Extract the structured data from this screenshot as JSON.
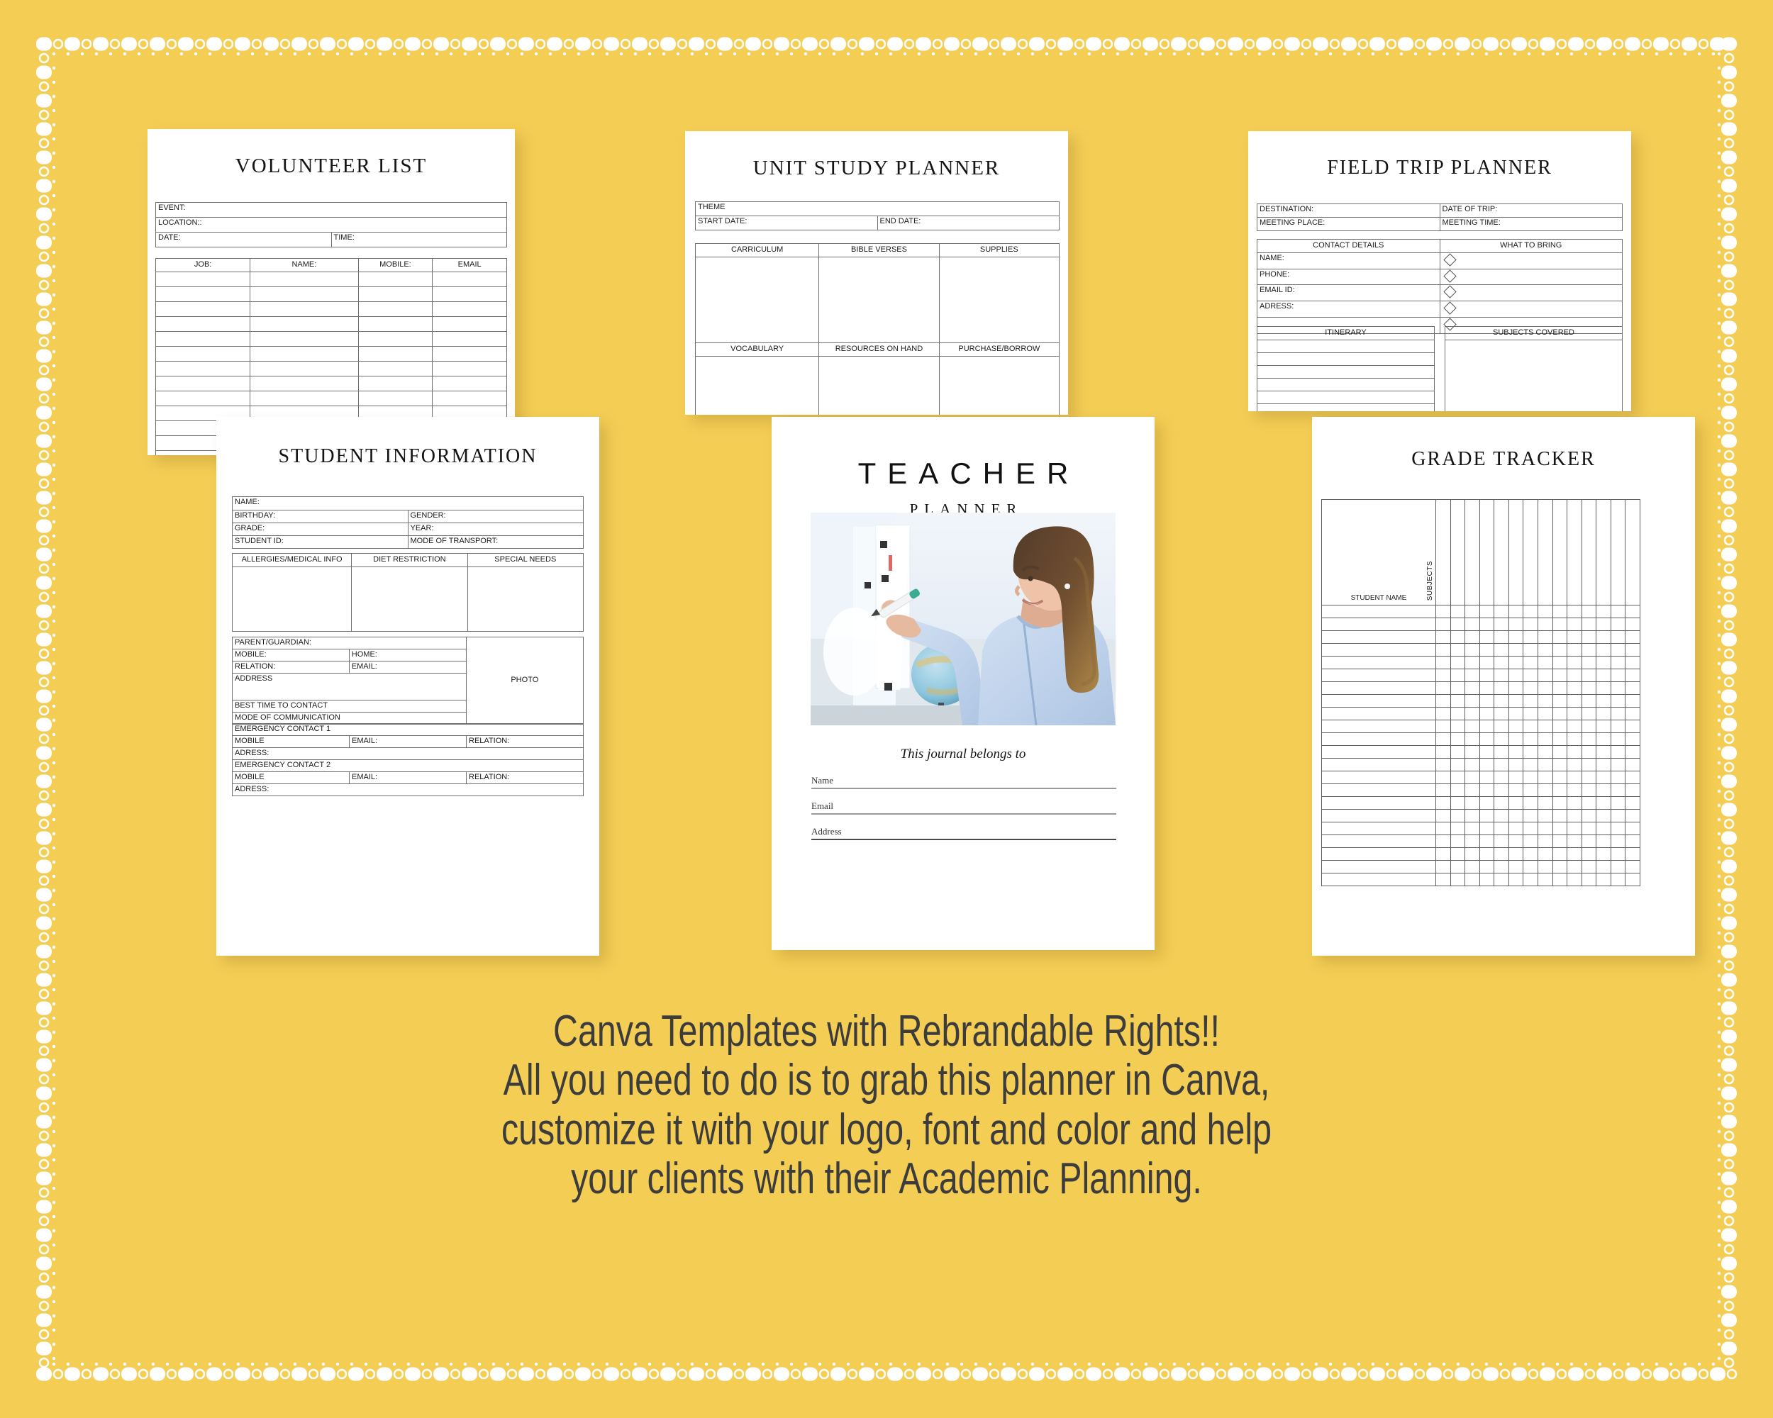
{
  "theme": {
    "background_color": "#F4CD55",
    "card_color": "#FFFFFF",
    "text_color": "#3C3C3C",
    "border_style": "dotted-white"
  },
  "cards": {
    "volunteer": {
      "title": "VOLUNTEER LIST",
      "fields": [
        {
          "label": "EVENT:"
        },
        {
          "label": "LOCATION::"
        },
        {
          "label": "DATE:",
          "label2": "TIME:"
        }
      ],
      "table_headers": [
        "JOB:",
        "NAME:",
        "MOBILE:",
        "EMAIL"
      ],
      "table_rows": 16
    },
    "unit_study": {
      "title": "UNIT STUDY PLANNER",
      "fields": [
        {
          "label": "THEME"
        },
        {
          "label": "START DATE:",
          "label2": "END DATE:"
        }
      ],
      "top_headers": [
        "CARRICULUM",
        "BIBLE VERSES",
        "SUPPLIES"
      ],
      "bottom_headers": [
        "VOCABULARY",
        "RESOURCES ON HAND",
        "PURCHASE/BORROW"
      ]
    },
    "field_trip": {
      "title": "FIELD TRIP PLANNER",
      "fields": [
        {
          "label": "DESTINATION:",
          "label2": "DATE OF TRIP:"
        },
        {
          "label": "MEETING PLACE:",
          "label2": "MEETING TIME:"
        }
      ],
      "contact_header": "CONTACT DETAILS",
      "bring_header": "WHAT TO BRING",
      "contact_rows": [
        "NAME:",
        "PHONE:",
        "EMAIL ID:",
        "ADRESS:",
        ""
      ],
      "bring_checkboxes": 5,
      "itinerary_header": "ITINERARY",
      "subjects_header": "SUBJECTS COVERED",
      "itinerary_rows": 7
    },
    "student_info": {
      "title": "STUDENT INFORMATION",
      "top_fields": [
        {
          "label": "NAME:"
        },
        {
          "label": "BIRTHDAY:",
          "label2": "GENDER:"
        },
        {
          "label": "GRADE:",
          "label2": "YEAR:"
        },
        {
          "label": "STUDENT ID:",
          "label2": "MODE OF TRANSPORT:"
        }
      ],
      "mid_headers": [
        "ALLERGIES/MEDICAL INFO",
        "DIET RESTRICTION",
        "SPECIAL NEEDS"
      ],
      "guardian": {
        "row1": "PARENT/GUARDIAN:",
        "row2a": "MOBILE:",
        "row2b": "HOME:",
        "row3a": "RELATION:",
        "row3b": "EMAIL:",
        "row4": "ADDRESS",
        "row5": "BEST TIME TO CONTACT",
        "row6": "MODE OF COMMUNICATION",
        "photo_label": "PHOTO"
      },
      "emergency": [
        {
          "title": "EMERGENCY CONTACT 1",
          "mobile": "MOBILE",
          "email": "EMAIL:",
          "relation": "RELATION:",
          "address": "ADRESS:"
        },
        {
          "title": "EMERGENCY CONTACT 2",
          "mobile": "MOBILE",
          "email": "EMAIL:",
          "relation": "RELATION:",
          "address": "ADRESS:"
        }
      ]
    },
    "teacher_planner": {
      "title": "TEACHER",
      "subtitle": "PLANNER",
      "belongs_to": "This journal belongs to",
      "fields": [
        "Name",
        "Email",
        "Address"
      ],
      "photo_alt": "teacher-writing-on-whiteboard-photo"
    },
    "grade_tracker": {
      "title": "GRADE TRACKER",
      "subjects_label": "SUBJECTS",
      "student_name_label": "STUDENT NAME",
      "subject_columns": 14,
      "student_rows": 22
    }
  },
  "caption": {
    "line1": "Canva Templates with Rebrandable Rights!!",
    "line2": "All you need to do is to grab this planner in Canva,",
    "line3": "customize it with your logo, font and color and help",
    "line4": "your clients with their Academic Planning."
  }
}
